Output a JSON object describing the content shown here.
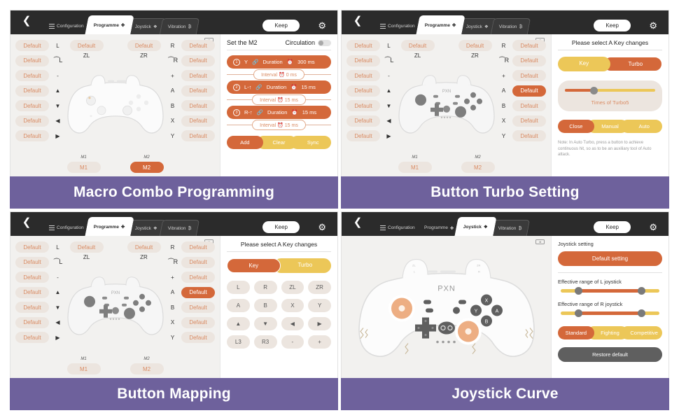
{
  "accent": {
    "orange": "#d4683a",
    "yellow": "#ecc758",
    "purple": "#6e619c",
    "beige": "#ece5df",
    "dark": "#2b2b2b"
  },
  "topbar": {
    "back_icon": "chevron-left-icon",
    "keep_label": "Keep",
    "gear_icon": "gear-icon",
    "tabs": [
      {
        "label": "Configuration",
        "icon": "list-icon"
      },
      {
        "label": "Programme",
        "icon": "plus-icon"
      },
      {
        "label": "Joystick",
        "icon": "crosshair-icon"
      },
      {
        "label": "Vibration",
        "icon": "wave-icon"
      }
    ]
  },
  "battery": "battery-icon",
  "mapping": {
    "default_label": "Default",
    "left_keys": [
      "L",
      "L-stick",
      "-",
      "▲",
      "▼",
      "◀",
      "▶"
    ],
    "right_keys": [
      "R",
      "R-stick",
      "+",
      "A",
      "B",
      "X",
      "Y"
    ],
    "top_keys": [
      "ZL",
      "ZR"
    ],
    "macro_caption": [
      "M1",
      "M2"
    ],
    "macro_buttons": [
      "M1",
      "M2"
    ]
  },
  "macro_panel": {
    "title": "Set the M2",
    "circulation_label": "Circulation",
    "steps": [
      {
        "index": "1",
        "key": "Y",
        "duration_label": "Duration",
        "duration": "300 ms"
      },
      {
        "index": "2",
        "key": "L-↑",
        "duration_label": "Duration",
        "duration": "15 ms"
      },
      {
        "index": "3",
        "key": "R-↑",
        "duration_label": "Duration",
        "duration": "15 ms"
      }
    ],
    "intervals": [
      {
        "label": "Interval",
        "value": "0 ms"
      },
      {
        "label": "Interval",
        "value": "15 ms"
      },
      {
        "label": "Interval",
        "value": "15 ms"
      }
    ],
    "buttons": {
      "add": "Add",
      "clear": "Clear",
      "sync": "Sync"
    }
  },
  "turbo_panel": {
    "title": "Please select A Key changes",
    "seg_key": "Key",
    "seg_turbo": "Turbo",
    "slider_label": "Times of Turbo5",
    "modes": [
      "Close",
      "Manual",
      "Auto"
    ],
    "note": "Note: In Auto Turbo, press a button to achieve continuous hit, so as to be an auxiliary tool of Auto attack."
  },
  "keymap_panel": {
    "title": "Please select A Key changes",
    "seg_key": "Key",
    "seg_turbo": "Turbo",
    "keys": [
      "L",
      "R",
      "ZL",
      "ZR",
      "A",
      "B",
      "X",
      "Y",
      "▲",
      "▼",
      "◀",
      "▶",
      "L3",
      "R3",
      "-",
      "+"
    ]
  },
  "joystick_panel": {
    "heading": "Joystick setting",
    "default_button": "Default setting",
    "left_range_label": "Effective range of L joystick",
    "right_range_label": "Effective range of R joystick",
    "modes": [
      "Standard",
      "Fighting",
      "Competitive"
    ],
    "restore": "Restore default"
  },
  "captions": {
    "q1": "Macro Combo Programming",
    "q2": "Button Turbo Setting",
    "q3": "Button Mapping",
    "q4": "Joystick Curve"
  },
  "controller": {
    "brand": "PXN",
    "face_buttons": [
      "X",
      "Y",
      "A",
      "B"
    ]
  }
}
